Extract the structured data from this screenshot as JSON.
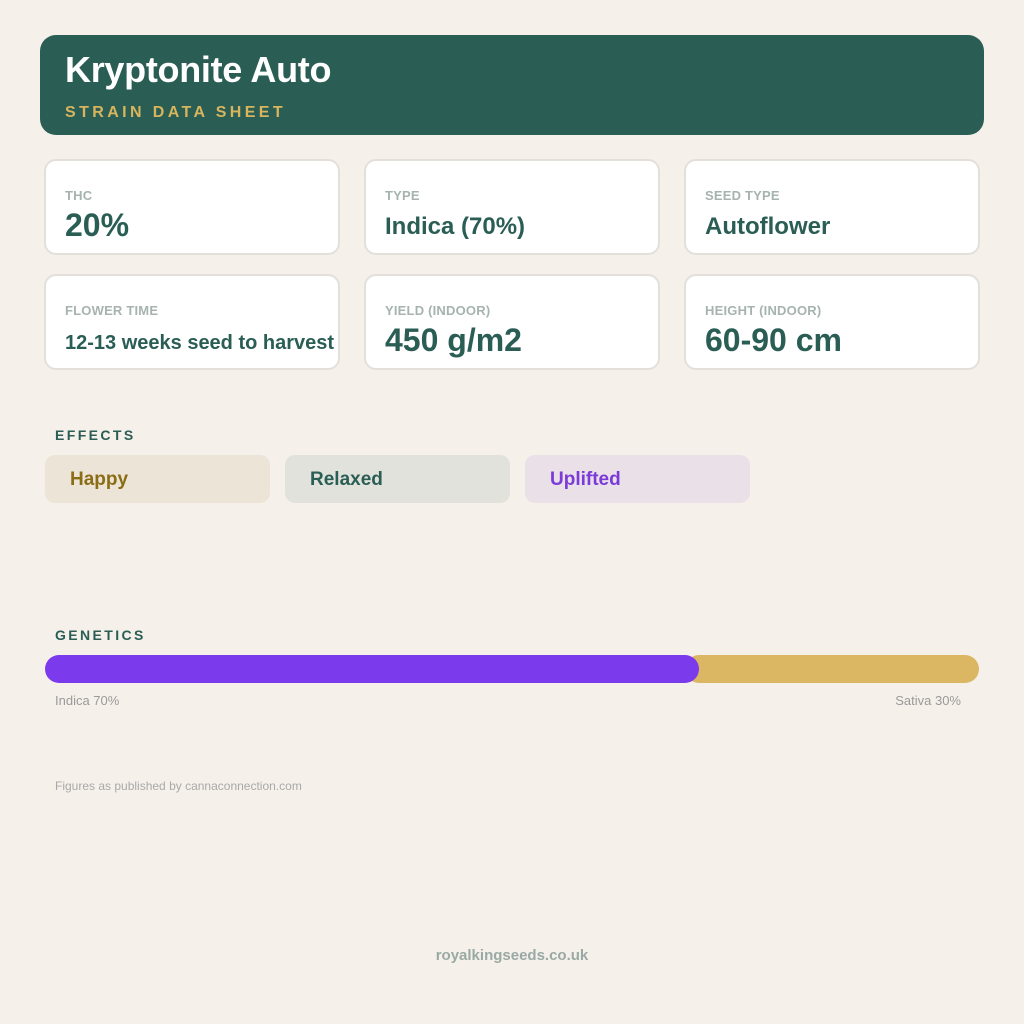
{
  "header": {
    "title": "Kryptonite Auto",
    "subtitle": "STRAIN DATA SHEET"
  },
  "stats": [
    {
      "label": "THC",
      "value": "20%"
    },
    {
      "label": "TYPE",
      "value": "Indica (70%)"
    },
    {
      "label": "SEED TYPE",
      "value": "Autoflower"
    },
    {
      "label": "FLOWER TIME",
      "value": "12-13 weeks seed to harvest"
    },
    {
      "label": "YIELD (INDOOR)",
      "value": "450 g/m2"
    },
    {
      "label": "HEIGHT (INDOOR)",
      "value": "60-90 cm"
    }
  ],
  "effects": {
    "title": "EFFECTS",
    "items": [
      {
        "label": "Happy",
        "color": "#8a6d14",
        "bg": "#ece4d6"
      },
      {
        "label": "Relaxed",
        "color": "#2a5e55",
        "bg": "#e2e2dc"
      },
      {
        "label": "Uplifted",
        "color": "#7a3bd8",
        "bg": "#eae0e8"
      }
    ]
  },
  "genetics": {
    "title": "GENETICS",
    "indica_fraction": 0.7,
    "sativa_fraction": 0.3,
    "indica_label": "Indica 70%",
    "sativa_label": "Sativa 30%",
    "indica_color": "#7c3aed",
    "sativa_color": "#dbb764"
  },
  "note": "Figures as published by cannaconnection.com",
  "footer": "royalkingseeds.co.uk",
  "colors": {
    "brand": "#2a5e55",
    "accent": "#d8b55c",
    "background": "#f5f0ea"
  }
}
